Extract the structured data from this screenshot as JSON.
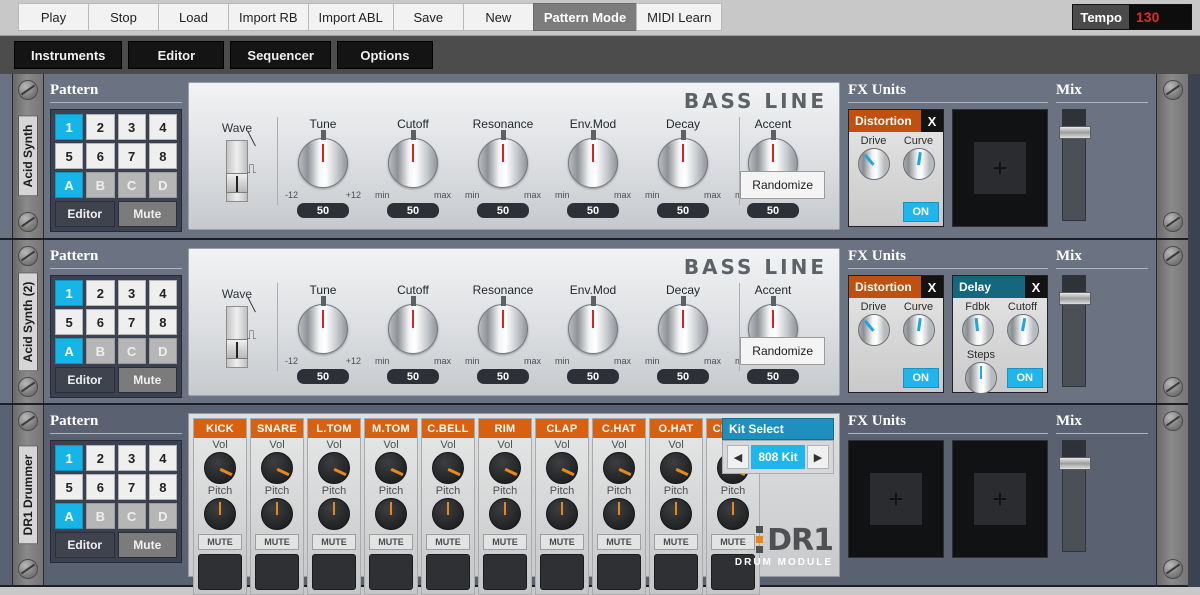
{
  "toolbar": {
    "buttons": [
      {
        "label": "Play",
        "active": false
      },
      {
        "label": "Stop",
        "active": false
      },
      {
        "label": "Load",
        "active": false
      },
      {
        "label": "Import RB",
        "active": false
      },
      {
        "label": "Import ABL",
        "active": false
      },
      {
        "label": "Save",
        "active": false
      },
      {
        "label": "New",
        "active": false
      },
      {
        "label": "Pattern Mode",
        "active": true
      },
      {
        "label": "MIDI Learn",
        "active": false
      }
    ],
    "tempo_label": "Tempo",
    "tempo_value": "130",
    "tempo_color": "#e02b2b"
  },
  "tabbar": {
    "tabs": [
      {
        "label": "Instruments"
      },
      {
        "label": "Editor"
      },
      {
        "label": "Sequencer"
      },
      {
        "label": "Options"
      }
    ]
  },
  "common": {
    "pattern_title": "Pattern",
    "fx_title": "FX Units",
    "mix_title": "Mix",
    "editor_label": "Editor",
    "mute_label": "Mute",
    "randomize_label": "Randomize",
    "brand_bassline": "BASS LINE",
    "pattern_numbers_row1": [
      "1",
      "2",
      "3",
      "4"
    ],
    "pattern_numbers_row2": [
      "5",
      "6",
      "7",
      "8"
    ],
    "pattern_letters": [
      "A",
      "B",
      "C",
      "D"
    ],
    "selected_number": "1",
    "selected_letter": "A",
    "accent_blue": "#17b4e8",
    "accent_orange": "#d9600f",
    "plus_glyph": "+"
  },
  "panels": [
    {
      "rail_label": "Acid Synth",
      "type": "synth",
      "wave_label": "Wave",
      "wave_symbols": [
        "saw-wave-icon",
        "square-wave-icon"
      ],
      "knobs": [
        {
          "name": "Tune",
          "min": "-12",
          "max": "+12",
          "value": "50"
        },
        {
          "name": "Cutoff",
          "min": "min",
          "max": "max",
          "value": "50"
        },
        {
          "name": "Resonance",
          "min": "min",
          "max": "max",
          "value": "50"
        },
        {
          "name": "Env.Mod",
          "min": "min",
          "max": "max",
          "value": "50"
        },
        {
          "name": "Decay",
          "min": "min",
          "max": "max",
          "value": "50"
        },
        {
          "name": "Accent",
          "min": "min",
          "max": "max",
          "value": "50"
        }
      ],
      "fx": [
        {
          "name": "Distortion",
          "close": "X",
          "header_color": "#c0500f",
          "on": "ON",
          "knobs": [
            {
              "label": "Drive"
            },
            {
              "label": "Curve"
            }
          ]
        },
        {
          "empty": true
        }
      ]
    },
    {
      "rail_label": "Acid Synth (2)",
      "type": "synth",
      "wave_label": "Wave",
      "wave_symbols": [
        "saw-wave-icon",
        "square-wave-icon"
      ],
      "knobs": [
        {
          "name": "Tune",
          "min": "-12",
          "max": "+12",
          "value": "50"
        },
        {
          "name": "Cutoff",
          "min": "min",
          "max": "max",
          "value": "50"
        },
        {
          "name": "Resonance",
          "min": "min",
          "max": "max",
          "value": "50"
        },
        {
          "name": "Env.Mod",
          "min": "min",
          "max": "max",
          "value": "50"
        },
        {
          "name": "Decay",
          "min": "min",
          "max": "max",
          "value": "50"
        },
        {
          "name": "Accent",
          "min": "min",
          "max": "max",
          "value": "50"
        }
      ],
      "fx": [
        {
          "name": "Distortion",
          "close": "X",
          "header_color": "#c0500f",
          "on": "ON",
          "knobs": [
            {
              "label": "Drive"
            },
            {
              "label": "Curve"
            }
          ]
        },
        {
          "name": "Delay",
          "close": "X",
          "header_color": "#136880",
          "on": "ON",
          "knobs": [
            {
              "label": "Fdbk"
            },
            {
              "label": "Cutoff"
            },
            {
              "label": "Steps"
            }
          ]
        }
      ]
    },
    {
      "rail_label": "DR1 Drummer",
      "type": "drum",
      "vol_label": "Vol",
      "pitch_label": "Pitch",
      "mute_label": "MUTE",
      "channels": [
        "KICK",
        "SNARE",
        "L.TOM",
        "M.TOM",
        "C.BELL",
        "RIM",
        "CLAP",
        "C.HAT",
        "O.HAT",
        "CRASH"
      ],
      "kit_select_title": "Kit Select",
      "kit_value": "808 Kit",
      "kit_prev": "◀",
      "kit_next": "▶",
      "logo_main": "DR1",
      "logo_sub": "DRUM MODULE",
      "fx": [
        {
          "empty": true
        },
        {
          "empty": true
        }
      ]
    }
  ]
}
